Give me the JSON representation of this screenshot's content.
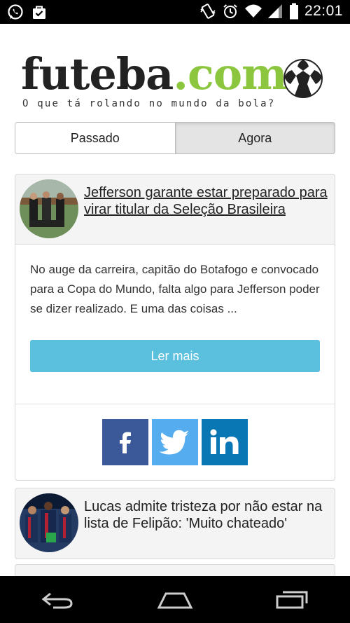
{
  "status_bar": {
    "time": "22:01",
    "left_icons": [
      "whatsapp-icon",
      "shopping-bag-icon"
    ],
    "right_icons": [
      "vibrate-icon",
      "alarm-icon",
      "wifi-icon",
      "signal-icon",
      "battery-icon"
    ]
  },
  "logo": {
    "name": "futeba",
    "tld": ".com",
    "tagline": "O que tá rolando no mundo da bola?",
    "brand_color": "#8cc63f"
  },
  "tabs": [
    {
      "label": "Passado",
      "active": false
    },
    {
      "label": "Agora",
      "active": true
    }
  ],
  "articles": [
    {
      "title": "Jefferson garante estar preparado para virar titular da Seleção Brasileira",
      "excerpt": "No auge da carreira, capitão do Botafogo e convocado para a Copa do Mundo, falta algo para Jefferson poder se dizer realizado. E uma das coisas ...",
      "read_more": "Ler mais"
    },
    {
      "title": "Lucas admite tristeza por não estar na lista de Felipão: 'Muito chateado'"
    }
  ],
  "share": [
    "facebook-icon",
    "twitter-icon",
    "linkedin-icon"
  ],
  "colors": {
    "read_more": "#5bc0de",
    "facebook": "#3b5998",
    "twitter": "#55acee",
    "linkedin": "#0a77b5"
  },
  "nav_bar": [
    "back-icon",
    "home-icon",
    "recent-apps-icon"
  ]
}
